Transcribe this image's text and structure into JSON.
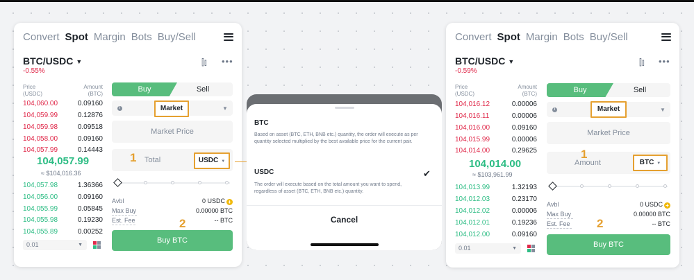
{
  "colors": {
    "buy_green": "#58bd7d",
    "sell_red": "#e0294a",
    "highlight_orange": "#e5a030"
  },
  "left": {
    "tabs": [
      "Convert",
      "Spot",
      "Margin",
      "Bots",
      "Buy/Sell"
    ],
    "pair": "BTC/USDC",
    "change": "-0.55%",
    "header_price": "Price\n(USDC)",
    "header_amount": "Amount\n(BTC)",
    "asks": [
      {
        "price": "104,060.00",
        "amount": "0.09160"
      },
      {
        "price": "104,059.99",
        "amount": "0.12876"
      },
      {
        "price": "104,059.98",
        "amount": "0.09518"
      },
      {
        "price": "104,058.00",
        "amount": "0.09160"
      },
      {
        "price": "104,057.99",
        "amount": "0.14443"
      }
    ],
    "mid_price": "104,057.99",
    "mid_sub": "≈ $104,016.36",
    "bids": [
      {
        "price": "104,057.98",
        "amount": "1.36366"
      },
      {
        "price": "104,056.00",
        "amount": "0.09160"
      },
      {
        "price": "104,055.99",
        "amount": "0.05845"
      },
      {
        "price": "104,055.98",
        "amount": "0.19230"
      },
      {
        "price": "104,055.89",
        "amount": "0.00252"
      }
    ],
    "buy_label": "Buy",
    "sell_label": "Sell",
    "order_type": "Market",
    "market_price": "Market Price",
    "total_placeholder": "Total",
    "unit": "USDC",
    "step1": "1",
    "step2": "2",
    "avbl_label": "Avbl",
    "avbl_value": "0 USDC",
    "maxbuy_label": "Max Buy",
    "maxbuy_value": "0.00000 BTC",
    "fee_label": "Est. Fee",
    "fee_value": "-- BTC",
    "precision": "0.01",
    "buy_button": "Buy BTC"
  },
  "sheet": {
    "opt1_title": "BTC",
    "opt1_desc": "Based on asset (BTC, ETH, BNB etc.) quantity, the order will execute as per quantity selected multiplied by the best available price for the current pair.",
    "opt2_title": "USDC",
    "opt2_desc": "The order will execute based on the total amount you want to spend, regardless of asset (BTC, ETH, BNB etc.) quantity.",
    "cancel": "Cancel"
  },
  "right": {
    "tabs": [
      "Convert",
      "Spot",
      "Margin",
      "Bots",
      "Buy/Sell"
    ],
    "pair": "BTC/USDC",
    "change": "-0.59%",
    "header_price": "Price\n(USDC)",
    "header_amount": "Amount\n(BTC)",
    "asks": [
      {
        "price": "104,016.12",
        "amount": "0.00006"
      },
      {
        "price": "104,016.11",
        "amount": "0.00006"
      },
      {
        "price": "104,016.00",
        "amount": "0.09160"
      },
      {
        "price": "104,015.99",
        "amount": "0.00006"
      },
      {
        "price": "104,014.00",
        "amount": "0.29625"
      }
    ],
    "mid_price": "104,014.00",
    "mid_sub": "≈ $103,961.99",
    "bids": [
      {
        "price": "104,013.99",
        "amount": "1.32193"
      },
      {
        "price": "104,012.03",
        "amount": "0.23170"
      },
      {
        "price": "104,012.02",
        "amount": "0.00006"
      },
      {
        "price": "104,012.01",
        "amount": "0.19236"
      },
      {
        "price": "104,012.00",
        "amount": "0.09160"
      }
    ],
    "buy_label": "Buy",
    "sell_label": "Sell",
    "order_type": "Market",
    "market_price": "Market Price",
    "amount_placeholder": "Amount",
    "unit": "BTC",
    "step1": "1",
    "step2": "2",
    "avbl_label": "Avbl",
    "avbl_value": "0 USDC",
    "maxbuy_label": "Max Buy",
    "maxbuy_value": "0.00000 BTC",
    "fee_label": "Est. Fee",
    "fee_value": "-- BTC",
    "precision": "0.01",
    "buy_button": "Buy BTC"
  }
}
